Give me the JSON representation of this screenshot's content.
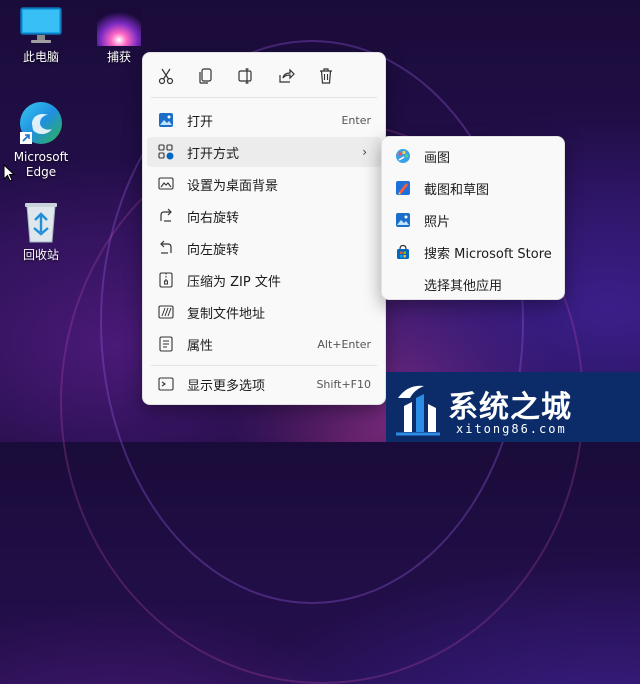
{
  "desktop": {
    "icons": [
      {
        "label": "此电脑",
        "icon": "monitor-icon"
      },
      {
        "label": "捕获",
        "icon": "image-thumbnail-icon"
      },
      {
        "label": "Microsoft Edge",
        "icon": "edge-icon"
      },
      {
        "label": "回收站",
        "icon": "recycle-bin-icon"
      }
    ]
  },
  "context_menu": {
    "toolbar": [
      {
        "label": "cut",
        "icon": "scissors-icon"
      },
      {
        "label": "copy",
        "icon": "copy-icon"
      },
      {
        "label": "rename",
        "icon": "rename-icon"
      },
      {
        "label": "share",
        "icon": "share-icon"
      },
      {
        "label": "delete",
        "icon": "trash-icon"
      }
    ],
    "items": [
      {
        "label": "打开",
        "shortcut": "Enter",
        "icon": "picture-icon"
      },
      {
        "label": "打开方式",
        "shortcut": "",
        "icon": "open-with-icon",
        "has_submenu": true
      },
      {
        "label": "设置为桌面背景",
        "shortcut": "",
        "icon": "wallpaper-icon"
      },
      {
        "label": "向右旋转",
        "shortcut": "",
        "icon": "rotate-right-icon"
      },
      {
        "label": "向左旋转",
        "shortcut": "",
        "icon": "rotate-left-icon"
      },
      {
        "label": "压缩为 ZIP 文件",
        "shortcut": "",
        "icon": "zip-icon"
      },
      {
        "label": "复制文件地址",
        "shortcut": "",
        "icon": "copy-path-icon"
      },
      {
        "label": "属性",
        "shortcut": "Alt+Enter",
        "icon": "properties-icon"
      },
      {
        "label": "显示更多选项",
        "shortcut": "Shift+F10",
        "icon": "more-options-icon"
      }
    ]
  },
  "submenu": {
    "items": [
      {
        "label": "画图",
        "icon": "paint-icon"
      },
      {
        "label": "截图和草图",
        "icon": "snip-sketch-icon"
      },
      {
        "label": "照片",
        "icon": "photos-icon"
      },
      {
        "label": "搜索 Microsoft Store",
        "icon": "store-icon"
      },
      {
        "label": "选择其他应用",
        "icon": ""
      }
    ]
  },
  "watermark": {
    "title": "系统之城",
    "url": "xitong86.com"
  },
  "colors": {
    "accent": "#0067c0",
    "menu_bg": "#f9f9f9",
    "watermark_bg": "#0c2c69"
  }
}
